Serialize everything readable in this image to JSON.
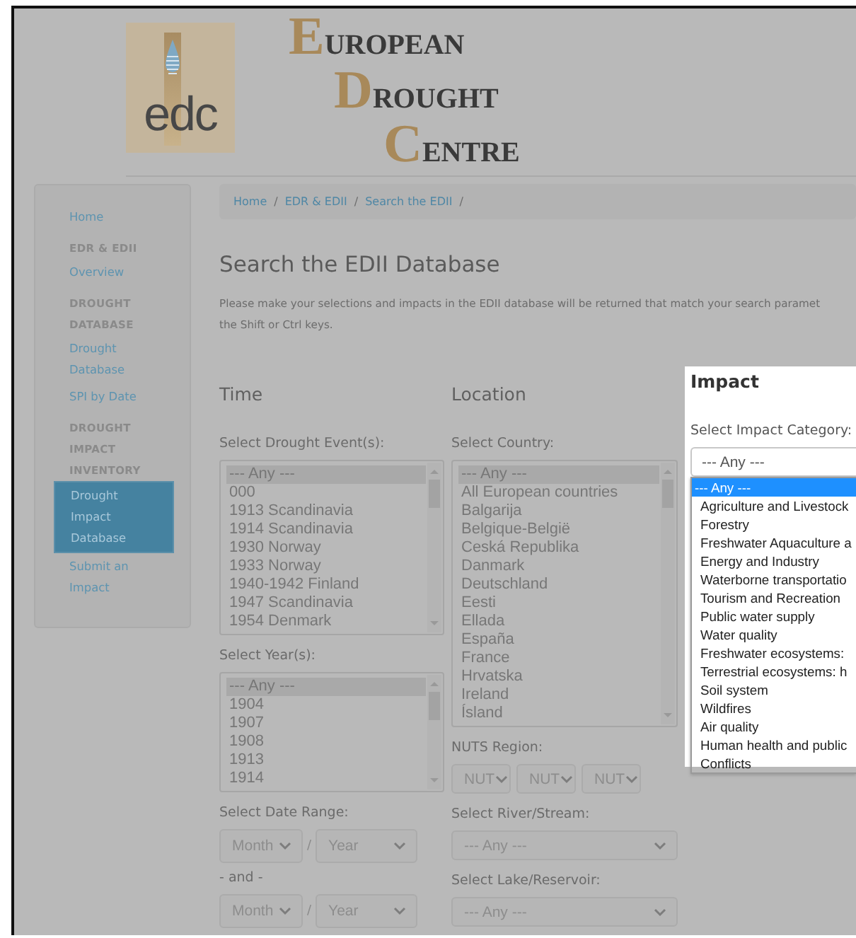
{
  "logo": {
    "text": "edc"
  },
  "site_title": [
    "EUROPEAN",
    "DROUGHT",
    "CENTRE"
  ],
  "sidebar": {
    "sections": [
      {
        "links": [
          {
            "label": "Home",
            "selected": false
          }
        ]
      },
      {
        "heading": "EDR & EDII",
        "links": [
          {
            "label": "Overview",
            "selected": false
          }
        ]
      },
      {
        "heading": "DROUGHT DATABASE",
        "links": [
          {
            "label": "Drought Database",
            "selected": false
          },
          {
            "label": "SPI by Date",
            "selected": false
          }
        ]
      },
      {
        "heading": "DROUGHT IMPACT INVENTORY",
        "links": [
          {
            "label": "Drought Impact Database",
            "selected": true
          },
          {
            "label": "Submit an Impact",
            "selected": false
          }
        ]
      }
    ]
  },
  "breadcrumb": {
    "separator": "/",
    "items": [
      "Home",
      "EDR & EDII",
      "Search the EDII"
    ]
  },
  "heading": "Search the EDII Database",
  "description": [
    "Please make your selections and impacts in the EDII database will be returned that match your search paramet",
    "the Shift or Ctrl keys."
  ],
  "columns": [
    {
      "heading": "Time",
      "fields": [
        {
          "kind": "listbox",
          "label": "Select Drought Event(s):",
          "options": [
            {
              "label": "--- Any ---",
              "selected": true
            },
            {
              "label": "000",
              "selected": false
            },
            {
              "label": "1913 Scandinavia",
              "selected": false
            },
            {
              "label": "1914 Scandinavia",
              "selected": false
            },
            {
              "label": "1930 Norway",
              "selected": false
            },
            {
              "label": "1933 Norway",
              "selected": false
            },
            {
              "label": "1940-1942 Finland",
              "selected": false
            },
            {
              "label": "1947 Scandinavia",
              "selected": false
            },
            {
              "label": "1954 Denmark",
              "selected": false
            }
          ]
        },
        {
          "kind": "listbox",
          "label": "Select Year(s):",
          "options": [
            {
              "label": "--- Any ---",
              "selected": true
            },
            {
              "label": "1904",
              "selected": false
            },
            {
              "label": "1907",
              "selected": false
            },
            {
              "label": "1908",
              "selected": false
            },
            {
              "label": "1913",
              "selected": false
            },
            {
              "label": "1914",
              "selected": false
            }
          ]
        },
        {
          "kind": "date-pair",
          "label": "Select Date Range:",
          "month": "Month",
          "separator": "/",
          "year": "Year"
        },
        {
          "kind": "date-pair",
          "label": "- and -",
          "month": "Month",
          "separator": "/",
          "year": "Year"
        }
      ]
    },
    {
      "heading": "Location",
      "fields": [
        {
          "kind": "listbox",
          "label": "Select Country:",
          "options": [
            {
              "label": "--- Any ---",
              "selected": true
            },
            {
              "label": "All European countries",
              "selected": false
            },
            {
              "label": "Balgarija",
              "selected": false
            },
            {
              "label": "Belgique-België",
              "selected": false
            },
            {
              "label": "Ceská Republika",
              "selected": false
            },
            {
              "label": "Danmark",
              "selected": false
            },
            {
              "label": "Deutschland",
              "selected": false
            },
            {
              "label": "Eesti",
              "selected": false
            },
            {
              "label": "Ellada",
              "selected": false
            },
            {
              "label": "España",
              "selected": false
            },
            {
              "label": "France",
              "selected": false
            },
            {
              "label": "Hrvatska",
              "selected": false
            },
            {
              "label": "Ireland",
              "selected": false
            },
            {
              "label": "Ísland",
              "selected": false
            }
          ]
        },
        {
          "kind": "select-row",
          "label": "NUTS Region:",
          "values": [
            "NUT",
            "NUT",
            "NUT"
          ]
        },
        {
          "kind": "select",
          "label": "Select River/Stream:",
          "value": "--- Any ---"
        },
        {
          "kind": "select",
          "label": "Select Lake/Reservoir:",
          "value": "--- Any ---"
        }
      ]
    }
  ],
  "impact": {
    "heading": "Impact",
    "label": "Select Impact Category:",
    "value": "--- Any ---",
    "expanded": true,
    "options": [
      {
        "label": "--- Any ---",
        "selected": true
      },
      {
        "label": "Agriculture and Livestock",
        "selected": false
      },
      {
        "label": "Forestry",
        "selected": false
      },
      {
        "label": "Freshwater Aquaculture a",
        "selected": false
      },
      {
        "label": "Energy and Industry",
        "selected": false
      },
      {
        "label": "Waterborne transportatio",
        "selected": false
      },
      {
        "label": "Tourism and Recreation",
        "selected": false
      },
      {
        "label": "Public water supply",
        "selected": false
      },
      {
        "label": "Water quality",
        "selected": false
      },
      {
        "label": "Freshwater ecosystems:",
        "selected": false
      },
      {
        "label": "Terrestrial ecosystems: h",
        "selected": false
      },
      {
        "label": "Soil system",
        "selected": false
      },
      {
        "label": "Wildfires",
        "selected": false
      },
      {
        "label": "Air quality",
        "selected": false
      },
      {
        "label": "Human health and public",
        "selected": false
      },
      {
        "label": "Conflicts",
        "selected": false
      }
    ]
  }
}
